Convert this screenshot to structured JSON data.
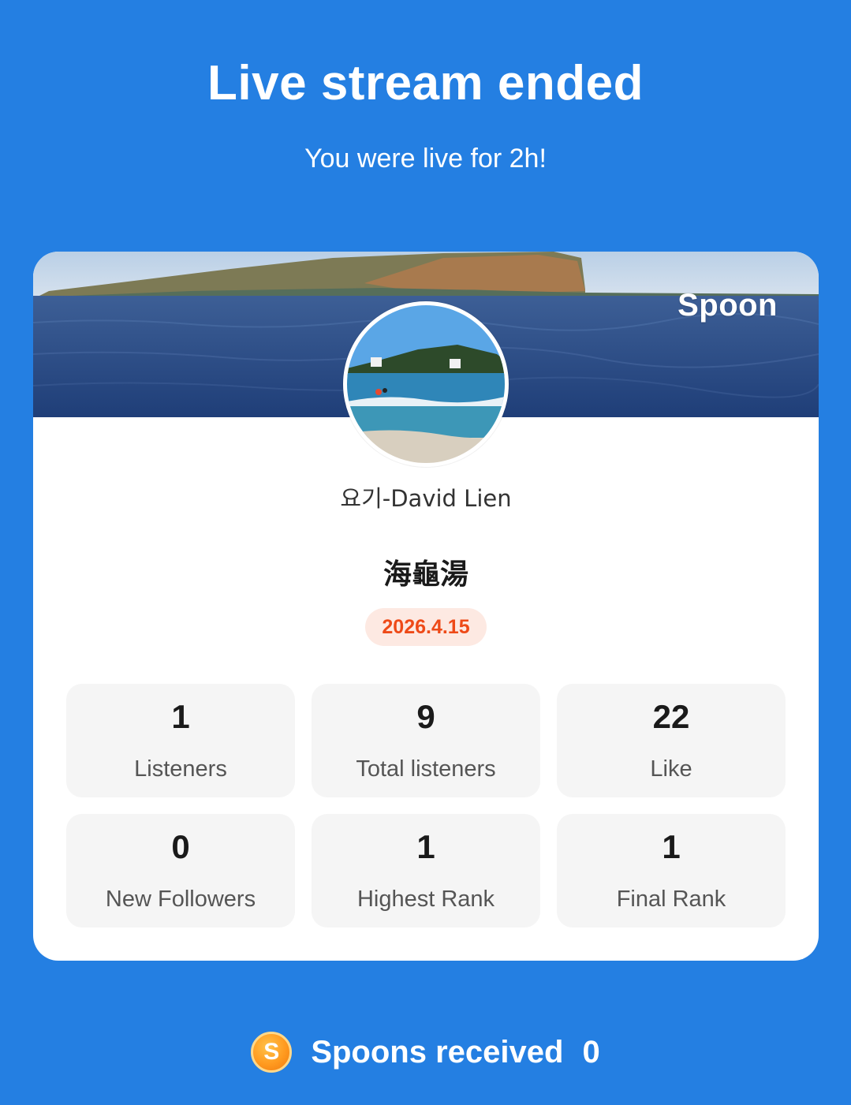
{
  "header": {
    "title": "Live stream ended",
    "subtitle": "You were live for 2h!"
  },
  "card": {
    "brand": "Spoon",
    "username": "요기-David Lien",
    "room_title": "海龜湯",
    "date": "2026.4.15",
    "stats": [
      {
        "value": "1",
        "label": "Listeners"
      },
      {
        "value": "9",
        "label": "Total listeners"
      },
      {
        "value": "22",
        "label": "Like"
      },
      {
        "value": "0",
        "label": "New Followers"
      },
      {
        "value": "1",
        "label": "Highest Rank"
      },
      {
        "value": "1",
        "label": "Final Rank"
      }
    ]
  },
  "footer": {
    "coin_letter": "S",
    "label": "Spoons received",
    "value": "0"
  },
  "colors": {
    "background": "#247fe2",
    "card": "#ffffff",
    "date_text": "#ee4a18",
    "date_bg": "#fde9e2",
    "stat_bg": "#f5f5f5"
  }
}
